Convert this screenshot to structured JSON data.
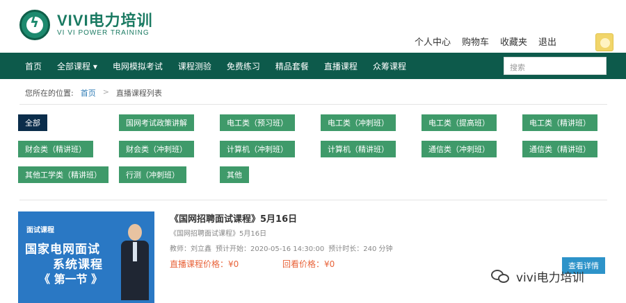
{
  "header": {
    "logo_title": "VIVI电力培训",
    "logo_subtitle": "VI VI POWER TRAINING",
    "user_nav": [
      "个人中心",
      "购物车",
      "收藏夹",
      "退出"
    ]
  },
  "navbar": {
    "items": [
      "首页",
      "全部课程 ▾",
      "电网模拟考试",
      "课程测验",
      "免费练习",
      "精品套餐",
      "直播课程",
      "众筹课程"
    ],
    "search_placeholder": "搜索"
  },
  "breadcrumb": {
    "label": "您所在的位置:",
    "home": "首页",
    "separator": ">",
    "current": "直播课程列表"
  },
  "categories": [
    {
      "label": "全部",
      "active": true
    },
    {
      "label": "国网考试政策讲解",
      "active": false
    },
    {
      "label": "电工类（预习班）",
      "active": false
    },
    {
      "label": "电工类（冲刺班）",
      "active": false
    },
    {
      "label": "电工类（提高班）",
      "active": false
    },
    {
      "label": "电工类（精讲班）",
      "active": false
    },
    {
      "label": "财会类（精讲班）",
      "active": false
    },
    {
      "label": "财会类（冲刺班）",
      "active": false
    },
    {
      "label": "计算机（冲刺班）",
      "active": false
    },
    {
      "label": "计算机（精讲班）",
      "active": false
    },
    {
      "label": "通信类（冲刺班）",
      "active": false
    },
    {
      "label": "通信类（精讲班）",
      "active": false
    },
    {
      "label": "其他工学类（精讲班）",
      "active": false
    },
    {
      "label": "行测（冲刺班）",
      "active": false
    },
    {
      "label": "其他",
      "active": false
    }
  ],
  "course": {
    "thumb_tag": "面试课程",
    "thumb_line1": "国家电网面试",
    "thumb_line2": "系统课程",
    "thumb_line3": "《 第一节 》",
    "title": "《国网招聘面试课程》5月16日",
    "subtitle": "《国网招聘面试课程》5月16日",
    "teacher": "教师：刘立鑫",
    "start": "预计开始：2020-05-16 14:30:00",
    "duration": "预计时长：240 分钟",
    "live_price": "直播课程价格：¥0",
    "replay_price": "回看价格：¥0",
    "view_button": "查看详情"
  },
  "watermark": {
    "text": "vivi电力培训"
  },
  "colors": {
    "nav_bg": "#0d5a4b",
    "category_bg": "#3f9a6a",
    "category_active_bg": "#0b2d4b",
    "price": "#e8633a",
    "button": "#2d93c9"
  }
}
